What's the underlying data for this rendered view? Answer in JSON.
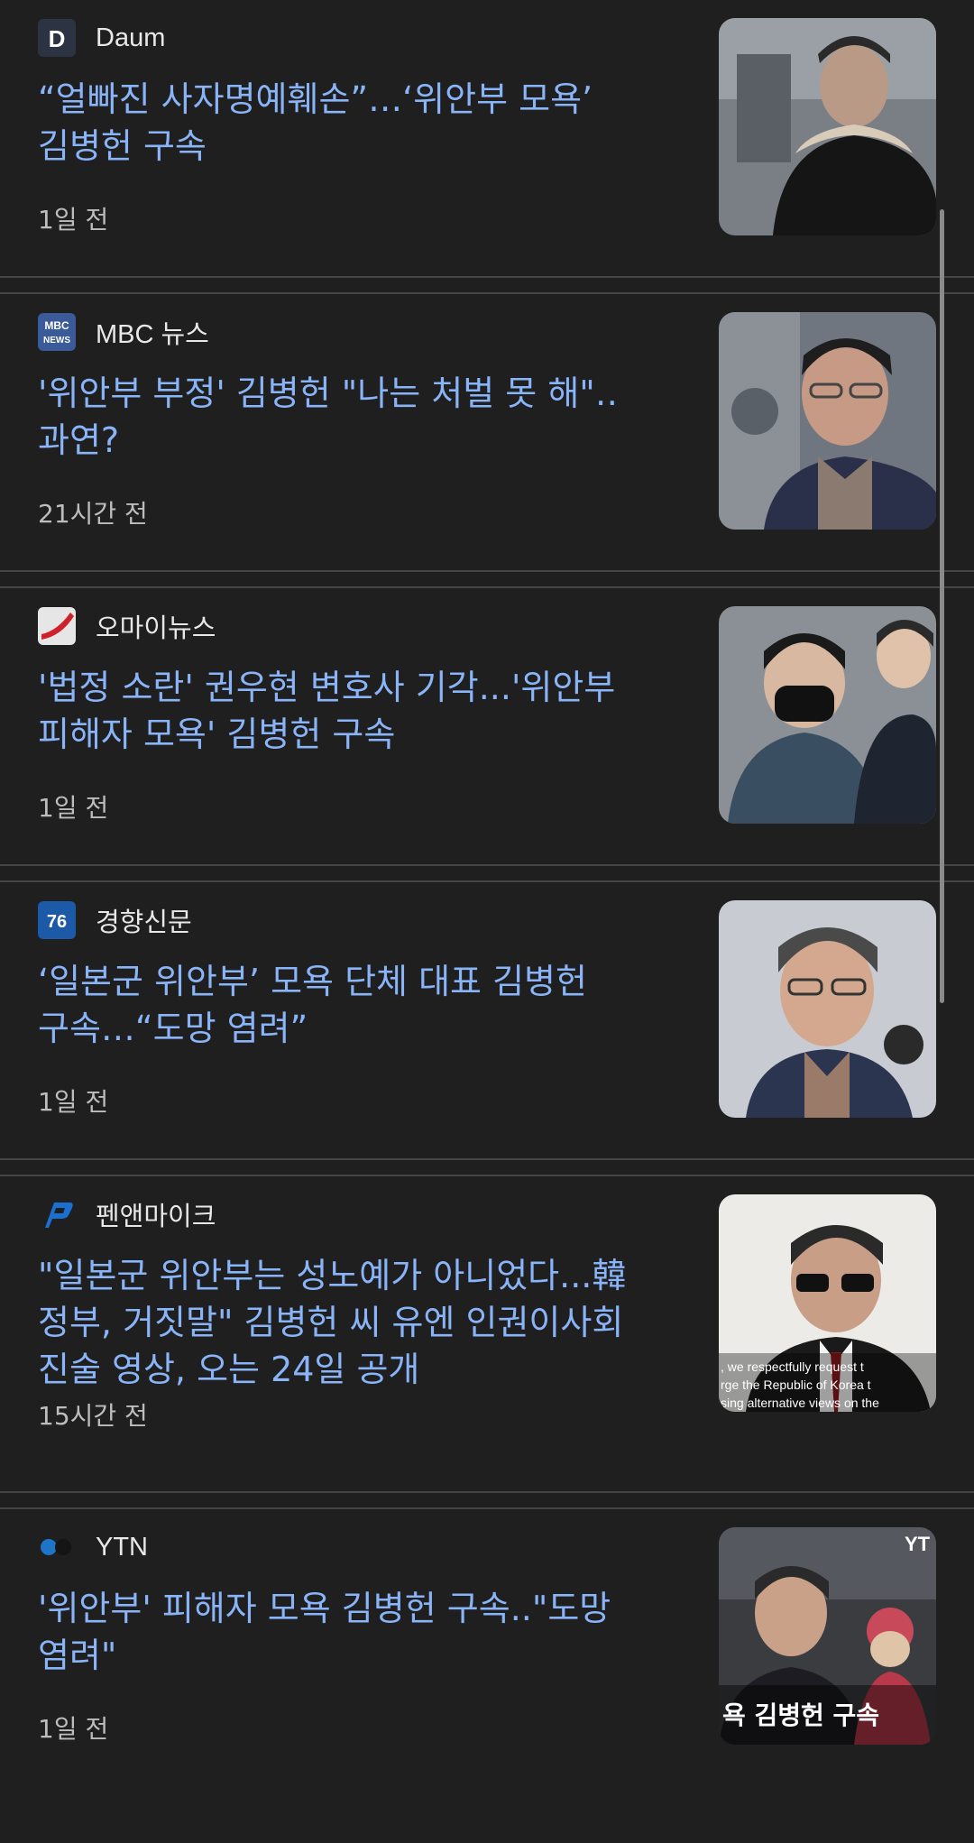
{
  "articles": [
    {
      "source": "Daum",
      "logo": "daum-logo",
      "headline": "“얼빠진 사자명예훼손”…‘위안부 모욕’ 김병헌 구속",
      "time": "1일 전",
      "thumbnail": "man-in-fur-collar-coat-photo"
    },
    {
      "source": "MBC 뉴스",
      "logo": "mbc-news-logo",
      "headline": "'위안부 부정' 김병헌 \"나는 처벌 못 해\"‥과연?",
      "time": "21시간 전",
      "thumbnail": "man-with-glasses-courthouse-photo"
    },
    {
      "source": "오마이뉴스",
      "logo": "ohmynews-logo",
      "headline": "'법정 소란' 권우현 변호사 기각...'위안부 피해자 모욕' 김병헌 구속",
      "time": "1일 전",
      "thumbnail": "man-in-mask-with-reporters-photo"
    },
    {
      "source": "경향신문",
      "logo": "kyunghyang-logo",
      "headline": "‘일본군 위안부’ 모욕 단체 대표 김병헌 구속…“도망 염려”",
      "time": "1일 전",
      "thumbnail": "man-with-glasses-outdoor-photo"
    },
    {
      "source": "펜앤마이크",
      "logo": "pennmike-logo",
      "headline": "\"일본군 위안부는 성노예가 아니었다...韓 정부, 거짓말\" 김병헌 씨 유엔 인권이사회 진술 영상, 오는 24일 공개",
      "time": "15시간 전",
      "thumbnail": "man-speaking-video-still",
      "thumbnail_caption": ", we respectfully request t\nrge the Republic of Korea t\nsing alternative views on the"
    },
    {
      "source": "YTN",
      "logo": "ytn-logo",
      "headline": "'위안부' 피해자 모욕 김병헌 구속..\"도망 염려\"",
      "time": "1일 전",
      "thumbnail": "broadcast-still-with-statue",
      "thumbnail_caption": "욕 김병헌 구속",
      "thumbnail_badge": "YT"
    }
  ],
  "colors": {
    "background": "#1f1f1f",
    "headline": "#8ab4f8",
    "source": "#e8e8e8",
    "time": "#bdbdbd",
    "divider": "#444444"
  }
}
